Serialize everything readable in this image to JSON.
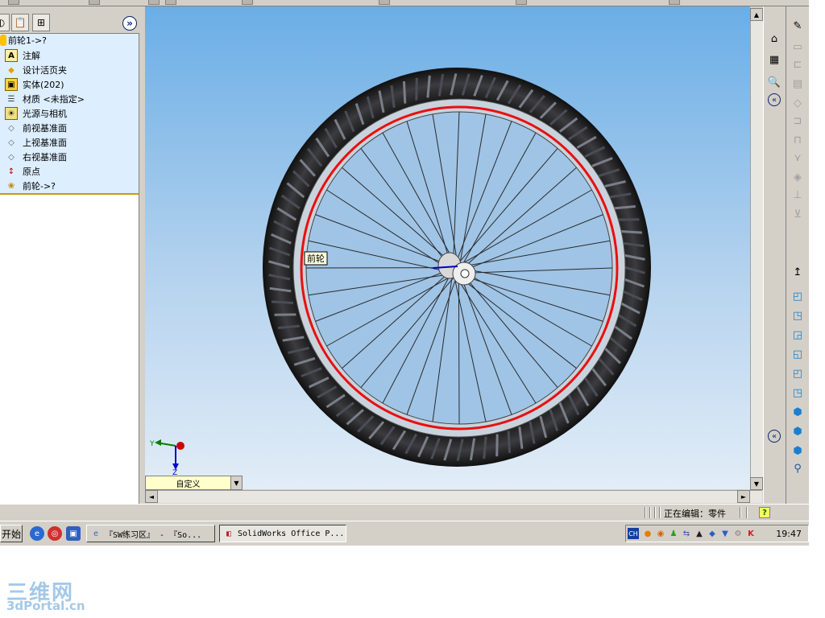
{
  "feature_tree": {
    "root": "前轮1->?",
    "items": [
      {
        "icon": "annotation-icon",
        "label": "注解"
      },
      {
        "icon": "design-binder-icon",
        "label": "设计活页夹"
      },
      {
        "icon": "solid-body-icon",
        "label": "实体(202)"
      },
      {
        "icon": "material-icon",
        "label": "材质 <未指定>"
      },
      {
        "icon": "lights-camera-icon",
        "label": "光源与相机"
      },
      {
        "icon": "plane-icon",
        "label": "前视基准面"
      },
      {
        "icon": "plane-icon",
        "label": "上视基准面"
      },
      {
        "icon": "plane-icon",
        "label": "右视基准面"
      },
      {
        "icon": "origin-icon",
        "label": "原点"
      },
      {
        "icon": "part-icon",
        "label": "前轮->?"
      }
    ]
  },
  "graphics": {
    "tooltip": "前轮",
    "view_orientation": "自定义",
    "triad": {
      "x_label": "Y",
      "z_label": "Z"
    }
  },
  "status_bar": {
    "text": "正在编辑：零件",
    "help": "?"
  },
  "taskbar": {
    "start_label": "开始",
    "tasks": [
      {
        "label": "『SW练习区』 - 『So...",
        "active": false
      },
      {
        "label": "SolidWorks Office P...",
        "active": true
      }
    ],
    "tray_lang": "CH",
    "clock": "19:47"
  },
  "watermark": {
    "cn": "三维网",
    "en": "3dPortal.cn"
  },
  "colors": {
    "rim_red": "#e81010",
    "background_top": "#6aaee6",
    "background_bottom": "#e2edf7",
    "tree_bg": "#ddeeff"
  }
}
